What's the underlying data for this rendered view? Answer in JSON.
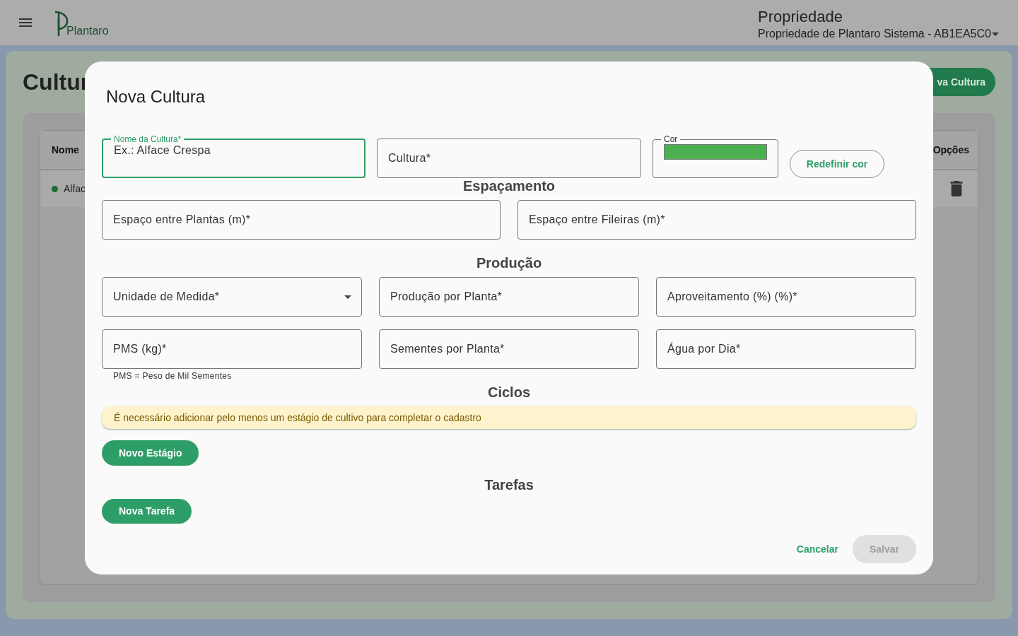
{
  "header": {
    "logo": "Plantaro",
    "property_label": "Propriedade",
    "property_value": "Propriedade de Plantaro Sistema - AB1EA5C0"
  },
  "page": {
    "title": "Cultur",
    "new_button": "va Cultura",
    "table": {
      "columns": [
        "Nome",
        "Opções"
      ],
      "rows": [
        {
          "name": "Alfac",
          "color": "#1f6b30"
        }
      ]
    }
  },
  "dialog": {
    "title": "Nova Cultura",
    "rows": [
      {
        "heading": null,
        "fields": [
          {
            "kind": "text",
            "label": "Nome da Cultura*",
            "placeholder": "Ex.: Alface Crespa",
            "focused": true
          },
          {
            "kind": "text",
            "label": "Cultura*",
            "focused": false
          },
          {
            "kind": "color",
            "label": "Cor",
            "color": "#4caf50"
          },
          {
            "kind": "button",
            "label": "Redefinir cor"
          }
        ]
      },
      {
        "heading": "Espaçamento",
        "fields": [
          {
            "kind": "text",
            "label": "Espaço entre Plantas (m)*",
            "focused": false
          },
          {
            "kind": "text",
            "label": "Espaço entre Fileiras (m)*",
            "focused": false
          }
        ]
      },
      {
        "heading": "Produção",
        "fields": [
          {
            "kind": "select",
            "label": "Unidade de Medida*",
            "focused": false
          },
          {
            "kind": "text",
            "label": "Produção por Planta*",
            "focused": false
          },
          {
            "kind": "text",
            "label": "Aproveitamento (%) (%)*",
            "focused": false
          }
        ]
      },
      {
        "heading": null,
        "fields": [
          {
            "kind": "text",
            "label": "PMS (kg)*",
            "helper": "PMS = Peso de Mil Sementes",
            "focused": false
          },
          {
            "kind": "text",
            "label": "Sementes por Planta*",
            "focused": false
          },
          {
            "kind": "text",
            "label": "Água por Dia*",
            "focused": false
          }
        ]
      }
    ],
    "cycles": {
      "heading": "Ciclos",
      "alert": "É necessário adicionar pelo menos um estágio de cultivo para completar o cadastro",
      "button": "Novo Estágio"
    },
    "tasks": {
      "heading": "Tarefas",
      "button": "Nova Tarefa"
    },
    "actions": [
      {
        "label": "Cancelar",
        "disabled": false
      },
      {
        "label": "Salvar",
        "disabled": true
      }
    ]
  }
}
